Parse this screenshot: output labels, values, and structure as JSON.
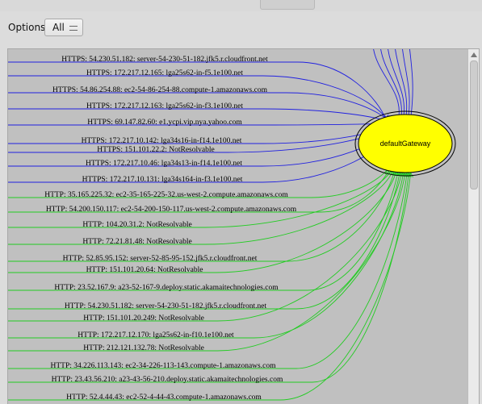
{
  "colors": {
    "https_edge": "#2020e0",
    "http_edge": "#22cc22",
    "node_fill": "#ffff00",
    "canvas_bg": "#c0c0c0"
  },
  "options": {
    "label": "Options:",
    "selected": "All"
  },
  "graph": {
    "target": "defaultGateway",
    "edges": [
      {
        "label": "HTTPS: 54.230.51.182: server-54-230-51-182.jfk5.r.cloudfront.net",
        "protocol": "https"
      },
      {
        "label": "HTTPS: 172.217.12.165: lga25s62-in-f5.1e100.net",
        "protocol": "https"
      },
      {
        "label": "HTTPS: 54.86.254.88: ec2-54-86-254-88.compute-1.amazonaws.com",
        "protocol": "https"
      },
      {
        "label": "HTTPS: 172.217.12.163: lga25s62-in-f3.1e100.net",
        "protocol": "https"
      },
      {
        "label": "HTTPS: 69.147.82.60: e1.ycpi.vip.nya.yahoo.com",
        "protocol": "https"
      },
      {
        "label": "HTTPS: 172.217.10.142: lga34s16-in-f14.1e100.net",
        "protocol": "https"
      },
      {
        "label": "HTTPS: 151.101.22.2: NotResolvable",
        "protocol": "https"
      },
      {
        "label": "HTTPS: 172.217.10.46: lga34s13-in-f14.1e100.net",
        "protocol": "https"
      },
      {
        "label": "HTTPS: 172.217.10.131: lga34s164-in-f3.1e100.net",
        "protocol": "https"
      },
      {
        "label": "HTTP: 35.165.225.32: ec2-35-165-225-32.us-west-2.compute.amazonaws.com",
        "protocol": "http"
      },
      {
        "label": "HTTP: 54.200.150.117: ec2-54-200-150-117.us-west-2.compute.amazonaws.com",
        "protocol": "http"
      },
      {
        "label": "HTTP: 104.20.31.2: NotResolvable",
        "protocol": "http"
      },
      {
        "label": "HTTP: 72.21.81.48: NotResolvable",
        "protocol": "http"
      },
      {
        "label": "HTTP: 52.85.95.152: server-52-85-95-152.jfk5.r.cloudfront.net",
        "protocol": "http"
      },
      {
        "label": "HTTP: 151.101.20.64: NotResolvable",
        "protocol": "http"
      },
      {
        "label": "HTTP: 23.52.167.9: a23-52-167-9.deploy.static.akamaitechnologies.com",
        "protocol": "http"
      },
      {
        "label": "HTTP: 54.230.51.182: server-54-230-51-182.jfk5.r.cloudfront.net",
        "protocol": "http"
      },
      {
        "label": "HTTP: 151.101.20.249: NotResolvable",
        "protocol": "http"
      },
      {
        "label": "HTTP: 172.217.12.170: lga25s62-in-f10.1e100.net",
        "protocol": "http"
      },
      {
        "label": "HTTP: 212.121.132.78: NotResolvable",
        "protocol": "http"
      },
      {
        "label": "HTTP: 34.226.113.143: ec2-34-226-113-143.compute-1.amazonaws.com",
        "protocol": "http"
      },
      {
        "label": "HTTP: 23.43.56.210: a23-43-56-210.deploy.static.akamaitechnologies.com",
        "protocol": "http"
      },
      {
        "label": "HTTP: 52.4.44.43: ec2-52-4-44-43.compute-1.amazonaws.com",
        "protocol": "http"
      }
    ]
  }
}
